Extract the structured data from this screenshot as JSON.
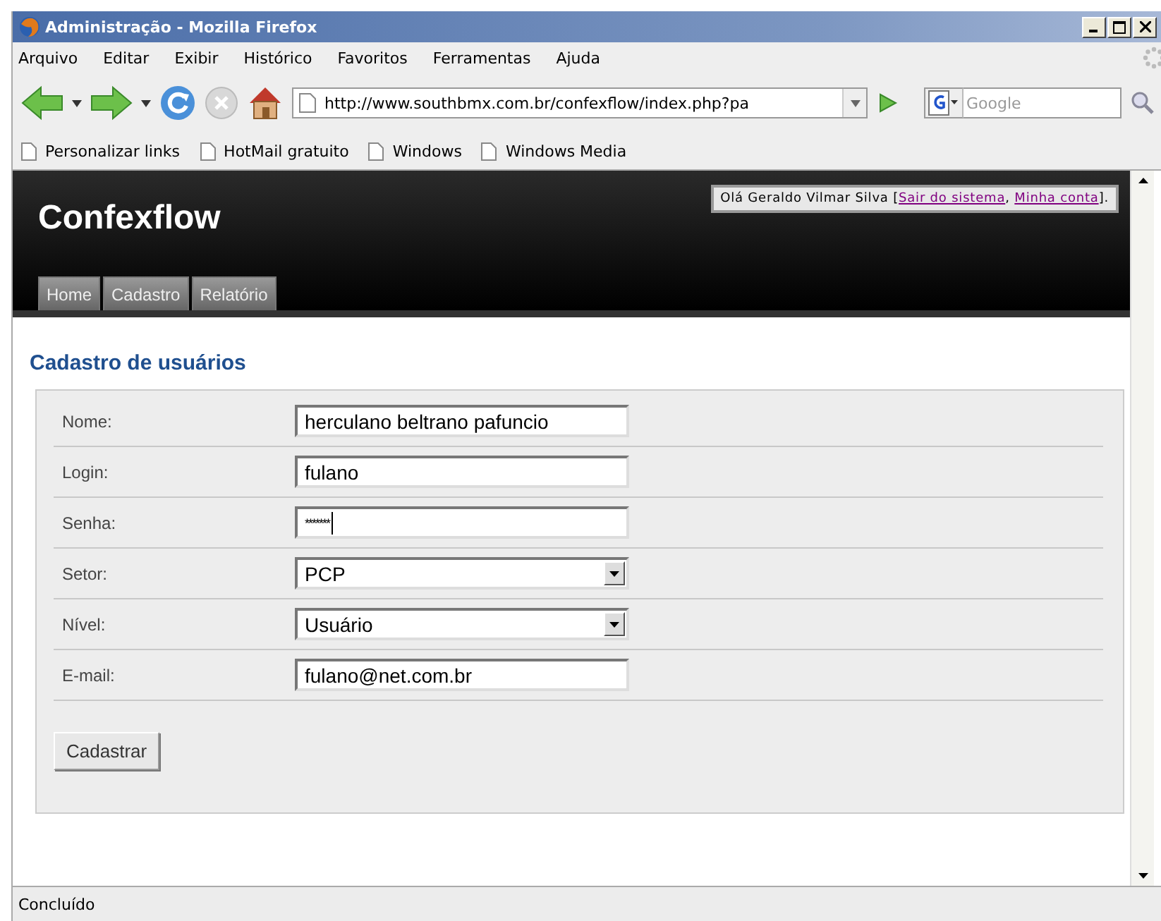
{
  "window": {
    "title": "Administração - Mozilla Firefox"
  },
  "menu": [
    "Arquivo",
    "Editar",
    "Exibir",
    "Histórico",
    "Favoritos",
    "Ferramentas",
    "Ajuda"
  ],
  "address": {
    "value": "http://www.southbmx.com.br/confexflow/index.php?pa"
  },
  "search": {
    "placeholder": "Google"
  },
  "bookmarks": [
    "Personalizar links",
    "HotMail gratuito",
    "Windows",
    "Windows Media"
  ],
  "site": {
    "title": "Confexflow",
    "greeting": "Olá Geraldo Vilmar Silva [",
    "links": [
      "Sair do sistema",
      "Minha conta"
    ],
    "separator": ", ",
    "greeting_end": "].",
    "nav": [
      {
        "label": "Home",
        "selected": false
      },
      {
        "label": "Cadastro",
        "selected": false
      },
      {
        "label": "Relatório",
        "selected": false
      }
    ]
  },
  "form": {
    "heading": "Cadastro de usuários",
    "fields": [
      {
        "label": "Nome:",
        "kind": "text",
        "value": "herculano beltrano pafuncio"
      },
      {
        "label": "Login:",
        "kind": "text",
        "value": "fulano"
      },
      {
        "label": "Senha:",
        "kind": "password",
        "value": "*******"
      },
      {
        "label": "Setor:",
        "kind": "select",
        "value": "PCP"
      },
      {
        "label": "Nível:",
        "kind": "select",
        "value": "Usuário"
      },
      {
        "label": "E-mail:",
        "kind": "text",
        "value": "fulano@net.com.br"
      }
    ],
    "submit": "Cadastrar"
  },
  "status_bar": "Concluído"
}
